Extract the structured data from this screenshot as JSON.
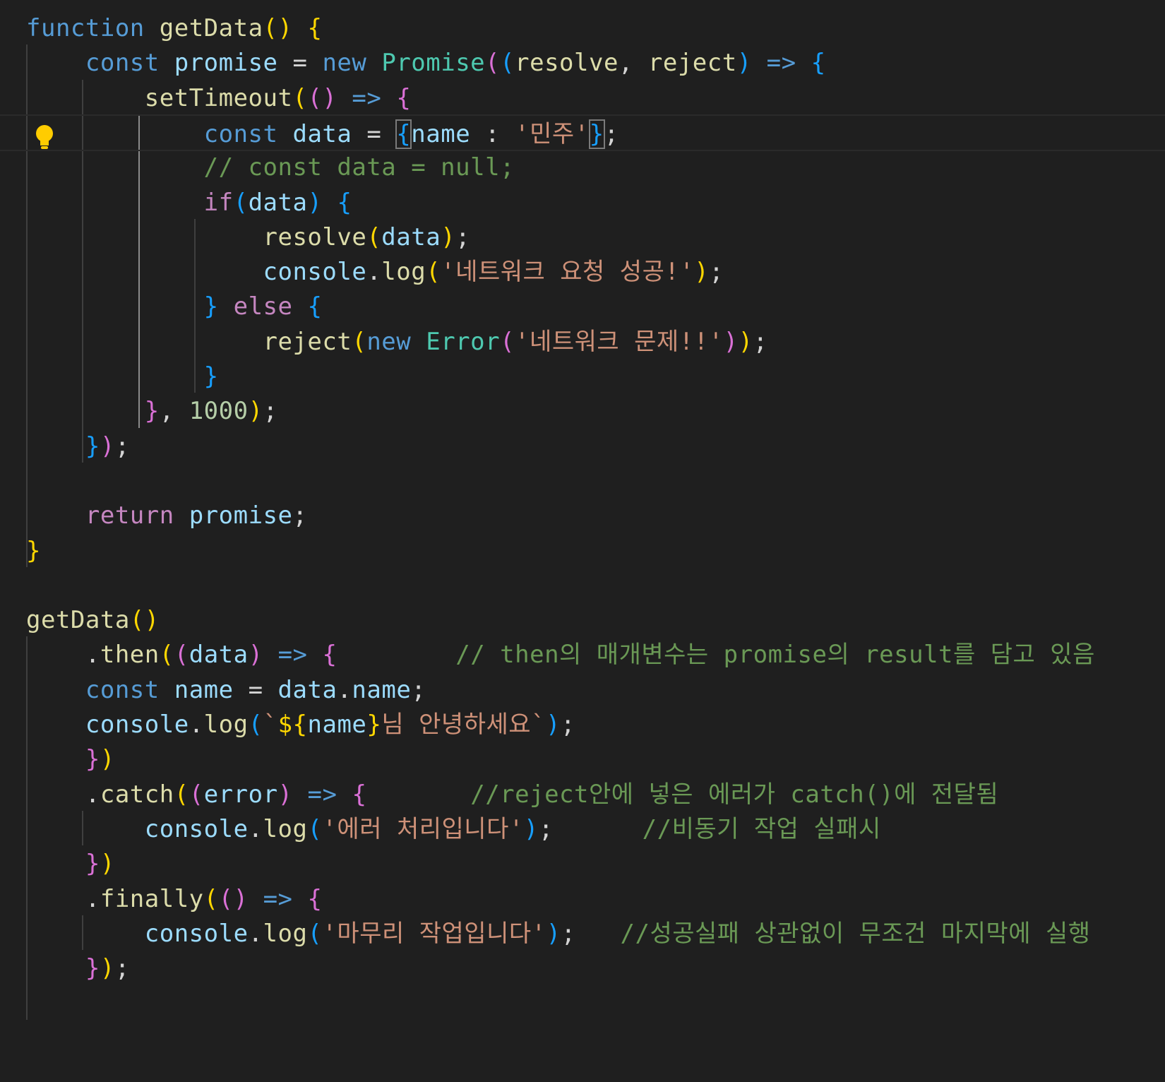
{
  "colors": {
    "background": "#1f1f1f",
    "keyword": "#569cd6",
    "control": "#c586c0",
    "function": "#dcdcaa",
    "variable": "#9cdcfe",
    "type": "#4ec9b0",
    "string": "#ce9178",
    "comment": "#6a9955",
    "number": "#b5cea8",
    "punctuation": "#d4d4d4",
    "bracket1": "#ffd700",
    "bracket2": "#da70d6",
    "bracket3": "#179fff",
    "lightbulb": "#ffcc00"
  },
  "icons": {
    "lightbulb": "lightbulb-icon"
  },
  "lines": [
    {
      "tokens": [
        {
          "t": "function",
          "c": "keyword"
        },
        {
          "t": " ",
          "c": "punctuation"
        },
        {
          "t": "getData",
          "c": "function"
        },
        {
          "t": "()",
          "c": "bracket1"
        },
        {
          "t": " ",
          "c": "punctuation"
        },
        {
          "t": "{",
          "c": "bracket1"
        }
      ]
    },
    {
      "tokens": [
        {
          "t": "    ",
          "c": "punctuation"
        },
        {
          "t": "const",
          "c": "keyword"
        },
        {
          "t": " ",
          "c": "punctuation"
        },
        {
          "t": "promise",
          "c": "variable"
        },
        {
          "t": " = ",
          "c": "punctuation"
        },
        {
          "t": "new",
          "c": "keyword"
        },
        {
          "t": " ",
          "c": "punctuation"
        },
        {
          "t": "Promise",
          "c": "type"
        },
        {
          "t": "(",
          "c": "bracket2"
        },
        {
          "t": "(",
          "c": "bracket3"
        },
        {
          "t": "resolve",
          "c": "function"
        },
        {
          "t": ", ",
          "c": "punctuation"
        },
        {
          "t": "reject",
          "c": "function"
        },
        {
          "t": ")",
          "c": "bracket3"
        },
        {
          "t": " ",
          "c": "punctuation"
        },
        {
          "t": "=>",
          "c": "keyword"
        },
        {
          "t": " ",
          "c": "punctuation"
        },
        {
          "t": "{",
          "c": "bracket3"
        }
      ]
    },
    {
      "tokens": [
        {
          "t": "        ",
          "c": "punctuation"
        },
        {
          "t": "setTimeout",
          "c": "function"
        },
        {
          "t": "(",
          "c": "bracket1"
        },
        {
          "t": "()",
          "c": "bracket2"
        },
        {
          "t": " ",
          "c": "punctuation"
        },
        {
          "t": "=>",
          "c": "keyword"
        },
        {
          "t": " ",
          "c": "punctuation"
        },
        {
          "t": "{",
          "c": "bracket2"
        }
      ]
    },
    {
      "tokens": [
        {
          "t": "            ",
          "c": "punctuation"
        },
        {
          "t": "const",
          "c": "keyword"
        },
        {
          "t": " ",
          "c": "punctuation"
        },
        {
          "t": "data",
          "c": "variable"
        },
        {
          "t": " = ",
          "c": "punctuation"
        },
        {
          "t": "{",
          "c": "bracket3",
          "box": true
        },
        {
          "t": "name",
          "c": "variable"
        },
        {
          "t": " : ",
          "c": "punctuation"
        },
        {
          "t": "'민주'",
          "c": "string"
        },
        {
          "t": "}",
          "c": "bracket3",
          "box": true
        },
        {
          "t": ";",
          "c": "punctuation"
        }
      ]
    },
    {
      "tokens": [
        {
          "t": "            ",
          "c": "punctuation"
        },
        {
          "t": "// const data = null;",
          "c": "comment"
        }
      ]
    },
    {
      "tokens": [
        {
          "t": "            ",
          "c": "punctuation"
        },
        {
          "t": "if",
          "c": "control"
        },
        {
          "t": "(",
          "c": "bracket3"
        },
        {
          "t": "data",
          "c": "variable"
        },
        {
          "t": ")",
          "c": "bracket3"
        },
        {
          "t": " ",
          "c": "punctuation"
        },
        {
          "t": "{",
          "c": "bracket3"
        }
      ]
    },
    {
      "tokens": [
        {
          "t": "                ",
          "c": "punctuation"
        },
        {
          "t": "resolve",
          "c": "function"
        },
        {
          "t": "(",
          "c": "bracket1"
        },
        {
          "t": "data",
          "c": "variable"
        },
        {
          "t": ")",
          "c": "bracket1"
        },
        {
          "t": ";",
          "c": "punctuation"
        }
      ]
    },
    {
      "tokens": [
        {
          "t": "                ",
          "c": "punctuation"
        },
        {
          "t": "console",
          "c": "variable"
        },
        {
          "t": ".",
          "c": "punctuation"
        },
        {
          "t": "log",
          "c": "function"
        },
        {
          "t": "(",
          "c": "bracket1"
        },
        {
          "t": "'네트워크 요청 성공!'",
          "c": "string"
        },
        {
          "t": ")",
          "c": "bracket1"
        },
        {
          "t": ";",
          "c": "punctuation"
        }
      ]
    },
    {
      "tokens": [
        {
          "t": "            ",
          "c": "punctuation"
        },
        {
          "t": "}",
          "c": "bracket3"
        },
        {
          "t": " ",
          "c": "punctuation"
        },
        {
          "t": "else",
          "c": "control"
        },
        {
          "t": " ",
          "c": "punctuation"
        },
        {
          "t": "{",
          "c": "bracket3"
        }
      ]
    },
    {
      "tokens": [
        {
          "t": "                ",
          "c": "punctuation"
        },
        {
          "t": "reject",
          "c": "function"
        },
        {
          "t": "(",
          "c": "bracket1"
        },
        {
          "t": "new",
          "c": "keyword"
        },
        {
          "t": " ",
          "c": "punctuation"
        },
        {
          "t": "Error",
          "c": "type"
        },
        {
          "t": "(",
          "c": "bracket2"
        },
        {
          "t": "'네트워크 문제!!'",
          "c": "string"
        },
        {
          "t": ")",
          "c": "bracket2"
        },
        {
          "t": ")",
          "c": "bracket1"
        },
        {
          "t": ";",
          "c": "punctuation"
        }
      ]
    },
    {
      "tokens": [
        {
          "t": "            ",
          "c": "punctuation"
        },
        {
          "t": "}",
          "c": "bracket3"
        }
      ]
    },
    {
      "tokens": [
        {
          "t": "        ",
          "c": "punctuation"
        },
        {
          "t": "}",
          "c": "bracket2"
        },
        {
          "t": ", ",
          "c": "punctuation"
        },
        {
          "t": "1000",
          "c": "number"
        },
        {
          "t": ")",
          "c": "bracket1"
        },
        {
          "t": ";",
          "c": "punctuation"
        }
      ]
    },
    {
      "tokens": [
        {
          "t": "    ",
          "c": "punctuation"
        },
        {
          "t": "}",
          "c": "bracket3"
        },
        {
          "t": ")",
          "c": "bracket2"
        },
        {
          "t": ";",
          "c": "punctuation"
        }
      ]
    },
    {
      "tokens": []
    },
    {
      "tokens": [
        {
          "t": "    ",
          "c": "punctuation"
        },
        {
          "t": "return",
          "c": "control"
        },
        {
          "t": " ",
          "c": "punctuation"
        },
        {
          "t": "promise",
          "c": "variable"
        },
        {
          "t": ";",
          "c": "punctuation"
        }
      ]
    },
    {
      "tokens": [
        {
          "t": "}",
          "c": "bracket1"
        }
      ]
    },
    {
      "tokens": []
    },
    {
      "tokens": [
        {
          "t": "getData",
          "c": "function"
        },
        {
          "t": "()",
          "c": "bracket1"
        }
      ]
    },
    {
      "tokens": [
        {
          "t": "    .",
          "c": "punctuation"
        },
        {
          "t": "then",
          "c": "function"
        },
        {
          "t": "(",
          "c": "bracket1"
        },
        {
          "t": "(",
          "c": "bracket2"
        },
        {
          "t": "data",
          "c": "variable"
        },
        {
          "t": ")",
          "c": "bracket2"
        },
        {
          "t": " ",
          "c": "punctuation"
        },
        {
          "t": "=>",
          "c": "keyword"
        },
        {
          "t": " ",
          "c": "punctuation"
        },
        {
          "t": "{",
          "c": "bracket2"
        },
        {
          "t": "        ",
          "c": "punctuation"
        },
        {
          "t": "// then의 매개변수는 promise의 result를 담고 있음",
          "c": "comment"
        }
      ]
    },
    {
      "tokens": [
        {
          "t": "    ",
          "c": "punctuation"
        },
        {
          "t": "const",
          "c": "keyword"
        },
        {
          "t": " ",
          "c": "punctuation"
        },
        {
          "t": "name",
          "c": "variable"
        },
        {
          "t": " = ",
          "c": "punctuation"
        },
        {
          "t": "data",
          "c": "variable"
        },
        {
          "t": ".",
          "c": "punctuation"
        },
        {
          "t": "name",
          "c": "variable"
        },
        {
          "t": ";",
          "c": "punctuation"
        }
      ]
    },
    {
      "tokens": [
        {
          "t": "    ",
          "c": "punctuation"
        },
        {
          "t": "console",
          "c": "variable"
        },
        {
          "t": ".",
          "c": "punctuation"
        },
        {
          "t": "log",
          "c": "function"
        },
        {
          "t": "(",
          "c": "bracket3"
        },
        {
          "t": "`",
          "c": "string"
        },
        {
          "t": "${",
          "c": "bracket1"
        },
        {
          "t": "name",
          "c": "variable"
        },
        {
          "t": "}",
          "c": "bracket1"
        },
        {
          "t": "님 안녕하세요`",
          "c": "string"
        },
        {
          "t": ")",
          "c": "bracket3"
        },
        {
          "t": ";",
          "c": "punctuation"
        }
      ]
    },
    {
      "tokens": [
        {
          "t": "    ",
          "c": "punctuation"
        },
        {
          "t": "}",
          "c": "bracket2"
        },
        {
          "t": ")",
          "c": "bracket1"
        }
      ]
    },
    {
      "tokens": [
        {
          "t": "    .",
          "c": "punctuation"
        },
        {
          "t": "catch",
          "c": "function"
        },
        {
          "t": "(",
          "c": "bracket1"
        },
        {
          "t": "(",
          "c": "bracket2"
        },
        {
          "t": "error",
          "c": "variable"
        },
        {
          "t": ")",
          "c": "bracket2"
        },
        {
          "t": " ",
          "c": "punctuation"
        },
        {
          "t": "=>",
          "c": "keyword"
        },
        {
          "t": " ",
          "c": "punctuation"
        },
        {
          "t": "{",
          "c": "bracket2"
        },
        {
          "t": "       ",
          "c": "punctuation"
        },
        {
          "t": "//reject안에 넣은 에러가 catch()에 전달됨",
          "c": "comment"
        }
      ]
    },
    {
      "tokens": [
        {
          "t": "        ",
          "c": "punctuation"
        },
        {
          "t": "console",
          "c": "variable"
        },
        {
          "t": ".",
          "c": "punctuation"
        },
        {
          "t": "log",
          "c": "function"
        },
        {
          "t": "(",
          "c": "bracket3"
        },
        {
          "t": "'에러 처리입니다'",
          "c": "string"
        },
        {
          "t": ")",
          "c": "bracket3"
        },
        {
          "t": ";",
          "c": "punctuation"
        },
        {
          "t": "      ",
          "c": "punctuation"
        },
        {
          "t": "//비동기 작업 실패시",
          "c": "comment"
        }
      ]
    },
    {
      "tokens": [
        {
          "t": "    ",
          "c": "punctuation"
        },
        {
          "t": "}",
          "c": "bracket2"
        },
        {
          "t": ")",
          "c": "bracket1"
        }
      ]
    },
    {
      "tokens": [
        {
          "t": "    .",
          "c": "punctuation"
        },
        {
          "t": "finally",
          "c": "function"
        },
        {
          "t": "(",
          "c": "bracket1"
        },
        {
          "t": "()",
          "c": "bracket2"
        },
        {
          "t": " ",
          "c": "punctuation"
        },
        {
          "t": "=>",
          "c": "keyword"
        },
        {
          "t": " ",
          "c": "punctuation"
        },
        {
          "t": "{",
          "c": "bracket2"
        }
      ]
    },
    {
      "tokens": [
        {
          "t": "        ",
          "c": "punctuation"
        },
        {
          "t": "console",
          "c": "variable"
        },
        {
          "t": ".",
          "c": "punctuation"
        },
        {
          "t": "log",
          "c": "function"
        },
        {
          "t": "(",
          "c": "bracket3"
        },
        {
          "t": "'마무리 작업입니다'",
          "c": "string"
        },
        {
          "t": ")",
          "c": "bracket3"
        },
        {
          "t": ";",
          "c": "punctuation"
        },
        {
          "t": "   ",
          "c": "punctuation"
        },
        {
          "t": "//성공실패 상관없이 무조건 마지막에 실행",
          "c": "comment"
        }
      ]
    },
    {
      "tokens": [
        {
          "t": "    ",
          "c": "punctuation"
        },
        {
          "t": "}",
          "c": "bracket2"
        },
        {
          "t": ")",
          "c": "bracket1"
        },
        {
          "t": ";",
          "c": "punctuation"
        }
      ]
    }
  ]
}
